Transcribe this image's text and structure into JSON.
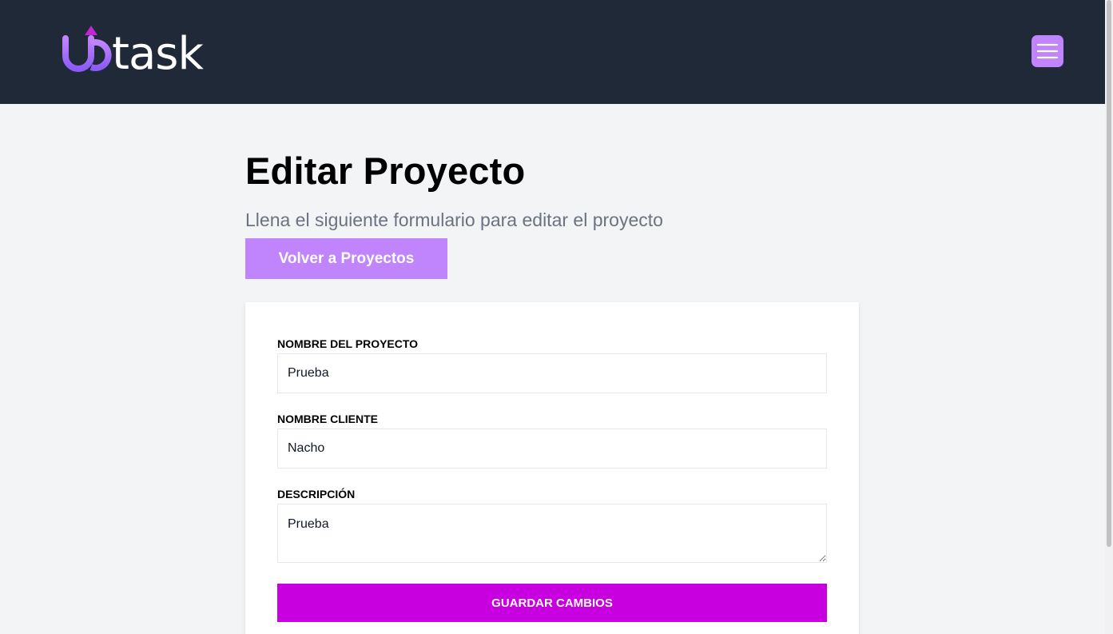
{
  "header": {
    "logo_text": "uptask",
    "menu_icon": "hamburger-menu-icon",
    "background_color": "#1f2937",
    "accent_color": "#c084fc"
  },
  "page": {
    "title": "Editar Proyecto",
    "subtitle": "Llena el siguiente formulario para editar el proyecto",
    "back_button_label": "Volver a Proyectos"
  },
  "form": {
    "fields": [
      {
        "label": "Nombre del Proyecto",
        "value": "Prueba"
      },
      {
        "label": "Nombre Cliente",
        "value": "Nacho"
      },
      {
        "label": "Descripción",
        "value": "Prueba"
      }
    ],
    "submit_label": "Guardar Cambios",
    "submit_color": "#c800df"
  }
}
